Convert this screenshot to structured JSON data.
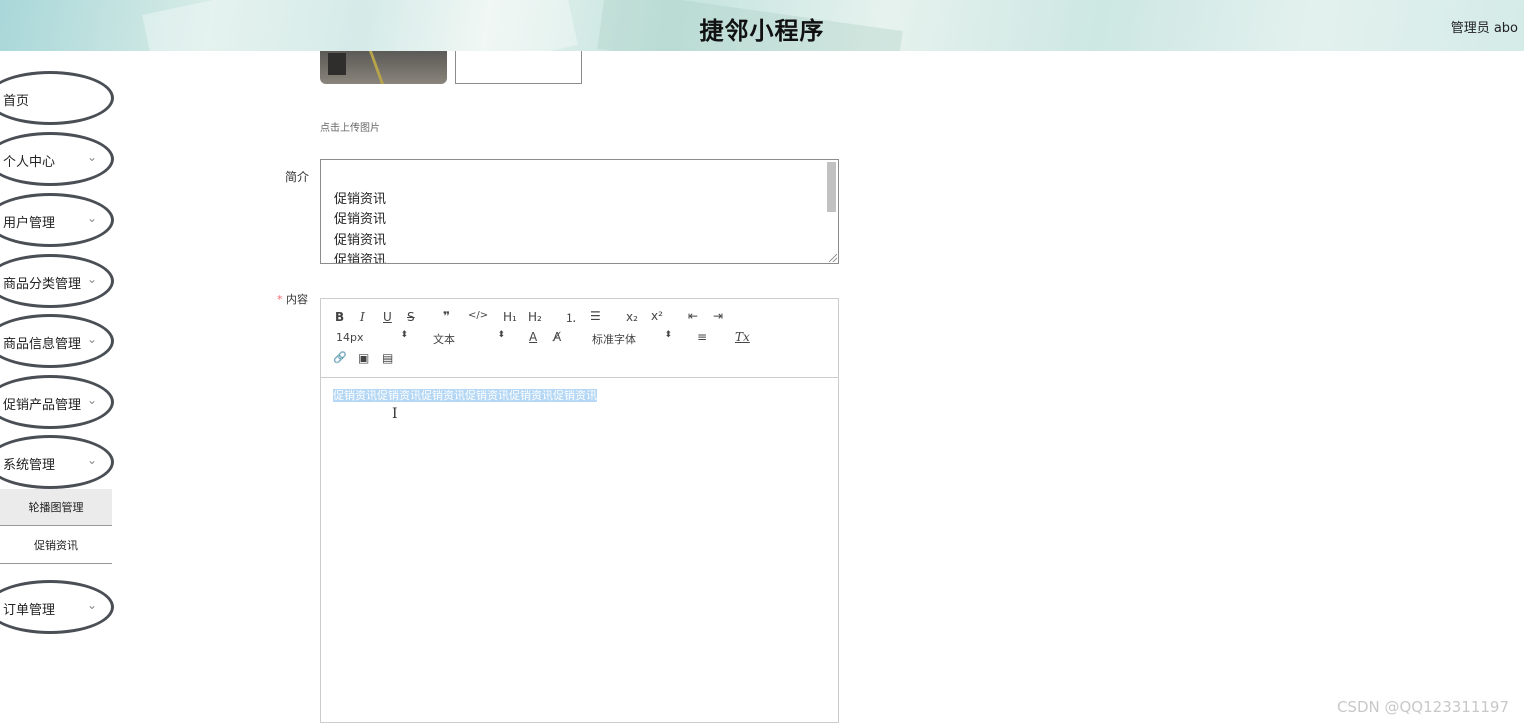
{
  "header": {
    "title": "捷邻小程序",
    "user": "管理员 abo"
  },
  "sidebar": {
    "items": [
      {
        "label": "首页",
        "has_chevron": false
      },
      {
        "label": "个人中心",
        "has_chevron": true
      },
      {
        "label": "用户管理",
        "has_chevron": true
      },
      {
        "label": "商品分类管理",
        "has_chevron": true
      },
      {
        "label": "商品信息管理",
        "has_chevron": true
      },
      {
        "label": "促销产品管理",
        "has_chevron": true
      },
      {
        "label": "系统管理",
        "has_chevron": true
      },
      {
        "label": "订单管理",
        "has_chevron": true
      }
    ],
    "sub_items": [
      {
        "label": "轮播图管理",
        "active": true
      },
      {
        "label": "促销资讯",
        "active": false
      }
    ],
    "chevron_glyph": "⌄"
  },
  "form": {
    "upload_hint": "点击上传图片",
    "intro_label": "简介",
    "intro_lines": [
      "促销资讯",
      "促销资讯",
      "促销资讯",
      "促销资讯"
    ],
    "content_required_mark": "*",
    "content_label": "内容"
  },
  "editor": {
    "toolbar": {
      "bold": "B",
      "italic": "I",
      "underline": "U",
      "strike": "S",
      "quote": "❞",
      "code": "</>",
      "h1": "H₁",
      "h2": "H₂",
      "ordered_list": "⒈",
      "bullet_list": "☰",
      "subscript": "x₂",
      "superscript": "x²",
      "outdent": "⇤",
      "indent": "⇥",
      "size": "14px",
      "header": "文本",
      "color": "A",
      "background": "A̸",
      "font": "标准字体",
      "align": "≡",
      "clean": "Tx",
      "link": "🔗",
      "image": "▣",
      "video": "▤",
      "picker_arrow": "⬍"
    },
    "content_text": "促销资讯促销资讯促销资讯促销资讯促销资讯促销资讯"
  },
  "watermark": "CSDN @QQ123311197",
  "colors": {
    "nav_border": "#4a4f55",
    "selection": "#b4d7f5",
    "required": "#f56c6c"
  }
}
